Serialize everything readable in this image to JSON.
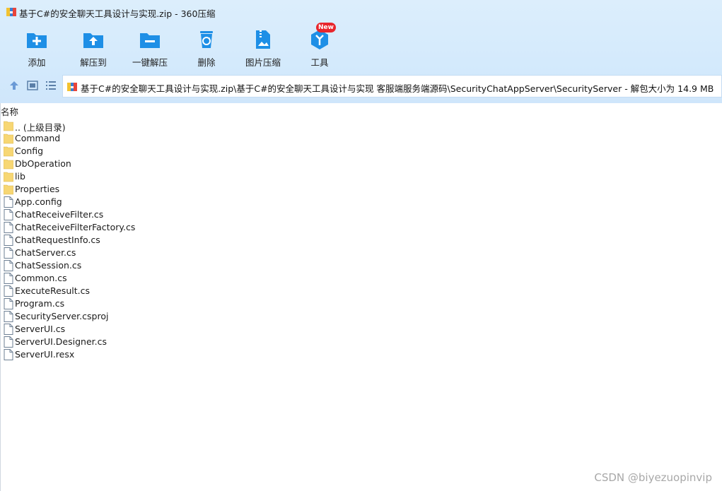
{
  "window": {
    "title": "基于C#的安全聊天工具设计与实现.zip - 360压缩",
    "app_icon": "360zip-archive-icon"
  },
  "toolbar": {
    "items": [
      {
        "id": "add",
        "label": "添加",
        "icon": "folder-plus-icon"
      },
      {
        "id": "extract-to",
        "label": "解压到",
        "icon": "folder-upload-icon"
      },
      {
        "id": "one-click-extract",
        "label": "一键解压",
        "icon": "folder-minus-icon"
      },
      {
        "id": "delete",
        "label": "删除",
        "icon": "recycle-bin-icon"
      },
      {
        "id": "image-compress",
        "label": "图片压缩",
        "icon": "image-zip-icon"
      },
      {
        "id": "tools",
        "label": "工具",
        "icon": "tools-cube-icon",
        "badge": "New"
      }
    ]
  },
  "nav": {
    "up_icon": "up-arrow-icon",
    "thumbnail_view_icon": "thumbnail-view-icon",
    "list_view_icon": "list-view-icon",
    "address": "基于C#的安全聊天工具设计与实现.zip\\基于C#的安全聊天工具设计与实现 客服端服务端源码\\SecurityChatAppServer\\SecurityServer - 解包大小为 14.9 MB"
  },
  "file_list": {
    "column_name": "名称",
    "items": [
      {
        "name": ".. (上级目录)",
        "type": "folder"
      },
      {
        "name": "Command",
        "type": "folder"
      },
      {
        "name": "Config",
        "type": "folder"
      },
      {
        "name": "DbOperation",
        "type": "folder"
      },
      {
        "name": "lib",
        "type": "folder"
      },
      {
        "name": "Properties",
        "type": "folder"
      },
      {
        "name": "App.config",
        "type": "file"
      },
      {
        "name": "ChatReceiveFilter.cs",
        "type": "file"
      },
      {
        "name": "ChatReceiveFilterFactory.cs",
        "type": "file"
      },
      {
        "name": "ChatRequestInfo.cs",
        "type": "file"
      },
      {
        "name": "ChatServer.cs",
        "type": "file"
      },
      {
        "name": "ChatSession.cs",
        "type": "file"
      },
      {
        "name": "Common.cs",
        "type": "file"
      },
      {
        "name": "ExecuteResult.cs",
        "type": "file"
      },
      {
        "name": "Program.cs",
        "type": "file"
      },
      {
        "name": "SecurityServer.csproj",
        "type": "file"
      },
      {
        "name": "ServerUI.cs",
        "type": "file"
      },
      {
        "name": "ServerUI.Designer.cs",
        "type": "file"
      },
      {
        "name": "ServerUI.resx",
        "type": "file"
      }
    ]
  },
  "watermark": "CSDN @biyezuopinvip",
  "colors": {
    "chrome_bg": "#d4eafc",
    "icon_blue": "#1e8fe6",
    "folder_yellow": "#f7d774",
    "badge_red": "#e8262c"
  }
}
